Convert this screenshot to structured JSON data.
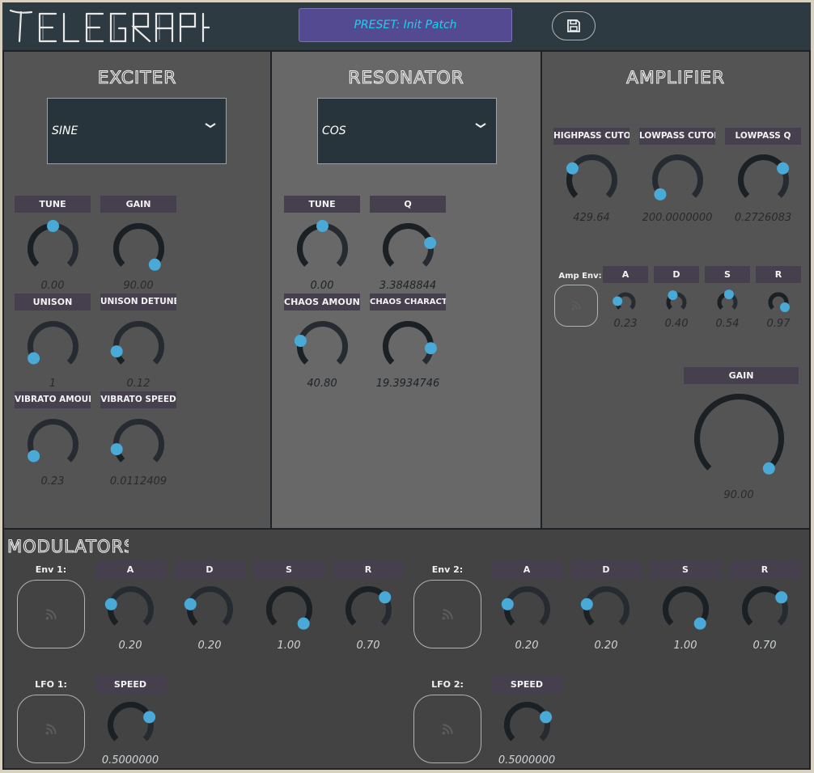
{
  "app": {
    "title": "TELEGRAPH"
  },
  "header": {
    "preset_text": "PRESET: Init Patch",
    "save_icon": "save-icon"
  },
  "colors": {
    "accent": "#49a9d7",
    "preset_bg": "#544a92",
    "preset_text": "#18d2ee",
    "label_bg": "#453f4e"
  },
  "exciter": {
    "title": "EXCITER",
    "waveform": "SINE",
    "knobs": [
      {
        "label": "TUNE",
        "value": "0.00"
      },
      {
        "label": "GAIN",
        "value": "90.00"
      },
      {
        "label": "UNISON",
        "value": "1"
      },
      {
        "label": "UNISON DETUNE",
        "value": "0.12"
      },
      {
        "label": "VIBRATO AMOUNT",
        "value": "0.23"
      },
      {
        "label": "VIBRATO SPEED",
        "value": "0.0112409"
      }
    ]
  },
  "resonator": {
    "title": "RESONATOR",
    "waveform": "COS",
    "knobs": [
      {
        "label": "TUNE",
        "value": "0.00"
      },
      {
        "label": "Q",
        "value": "3.3848844"
      },
      {
        "label": "CHAOS AMOUNT",
        "value": "40.80"
      },
      {
        "label": "CHAOS CHARACTER",
        "value": "19.3934746"
      }
    ]
  },
  "amplifier": {
    "title": "AMPLIFIER",
    "filters": [
      {
        "label": "HIGHPASS CUTOFF",
        "value": "429.64"
      },
      {
        "label": "LOWPASS CUTOFF",
        "value": "200.0000000"
      },
      {
        "label": "LOWPASS Q",
        "value": "0.2726083"
      }
    ],
    "amp_env_label": "Amp Env:",
    "env": [
      {
        "label": "A",
        "value": "0.23"
      },
      {
        "label": "D",
        "value": "0.40"
      },
      {
        "label": "S",
        "value": "0.54"
      },
      {
        "label": "R",
        "value": "0.97"
      }
    ],
    "gain": {
      "label": "GAIN",
      "value": "90.00"
    }
  },
  "modulators": {
    "title": "MODULATORS",
    "env1": {
      "label": "Env 1:",
      "knobs": [
        {
          "label": "A",
          "value": "0.20"
        },
        {
          "label": "D",
          "value": "0.20"
        },
        {
          "label": "S",
          "value": "1.00"
        },
        {
          "label": "R",
          "value": "0.70"
        }
      ]
    },
    "env2": {
      "label": "Env 2:",
      "knobs": [
        {
          "label": "A",
          "value": "0.20"
        },
        {
          "label": "D",
          "value": "0.20"
        },
        {
          "label": "S",
          "value": "1.00"
        },
        {
          "label": "R",
          "value": "0.70"
        }
      ]
    },
    "lfo1": {
      "label": "LFO 1:",
      "speed_label": "SPEED",
      "speed_value": "0.5000000"
    },
    "lfo2": {
      "label": "LFO 2:",
      "speed_label": "SPEED",
      "speed_value": "0.5000000"
    }
  },
  "knob_levels": {
    "exciter": [
      0.5,
      1.0,
      0.05,
      0.12,
      0.05,
      0.12
    ],
    "resonator": [
      0.5,
      0.78,
      0.22,
      0.85
    ],
    "amp_filters": [
      0.28,
      0.02,
      0.72
    ],
    "amp_env": [
      0.2,
      0.4,
      0.54,
      0.97
    ],
    "amp_gain": 1.0,
    "env1": [
      0.22,
      0.22,
      1.0,
      0.7
    ],
    "env2": [
      0.22,
      0.22,
      1.0,
      0.7
    ],
    "lfo1": 0.75,
    "lfo2": 0.75
  }
}
